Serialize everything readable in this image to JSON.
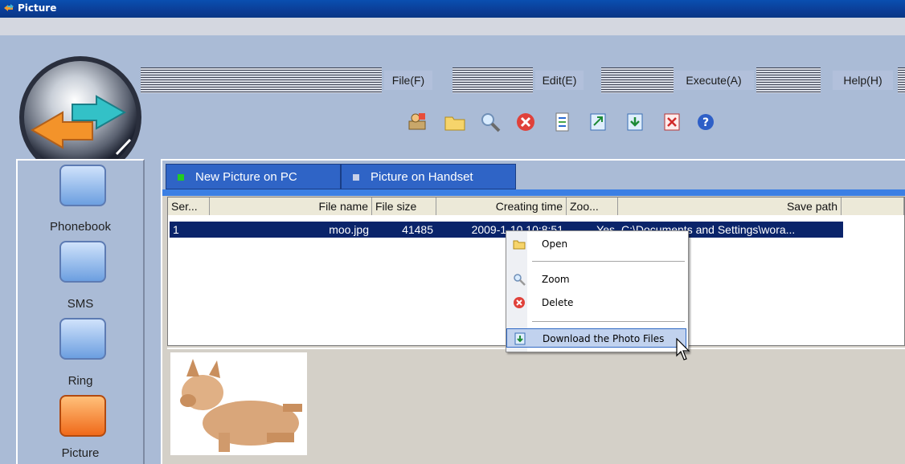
{
  "window": {
    "title": "Picture"
  },
  "menu": {
    "file": "File(F)",
    "edit": "Edit(E)",
    "execute": "Execute(A)",
    "help": "Help(H)"
  },
  "toolbar": {
    "icons": [
      "contacts-icon",
      "open-folder-icon",
      "zoom-icon",
      "delete-icon",
      "edit-document-icon",
      "upload-icon",
      "download-icon",
      "remove-icon",
      "help-icon"
    ]
  },
  "sidebar": {
    "items": [
      {
        "label": "Phonebook"
      },
      {
        "label": "SMS"
      },
      {
        "label": "Ring"
      },
      {
        "label": "Picture"
      }
    ]
  },
  "tabs": [
    {
      "label": "New Picture on PC",
      "marker_color": "#22cc22"
    },
    {
      "label": "Picture on Handset",
      "marker_color": "#c8d0e8"
    }
  ],
  "table": {
    "columns": [
      "Ser...",
      "File name",
      "File size",
      "Creating time",
      "Zoo...",
      "Save path"
    ],
    "rows": [
      {
        "ser": "1",
        "file_name": "moo.jpg",
        "file_size": "41485",
        "creating_time": "2009-1-10 10:8:51",
        "zoom": "Yes",
        "save_path": "C:\\Documents and Settings\\wora..."
      }
    ]
  },
  "context_menu": {
    "items": [
      {
        "label": "Open",
        "icon": "open-folder-icon"
      },
      {
        "label": "Zoom",
        "icon": "zoom-icon"
      },
      {
        "label": "Delete",
        "icon": "delete-icon"
      },
      {
        "label": "Download the Photo Files",
        "icon": "download-icon"
      }
    ]
  },
  "colors": {
    "accent_blue": "#2f64c6",
    "selection": "#0a246a",
    "background": "#aabbd6"
  }
}
